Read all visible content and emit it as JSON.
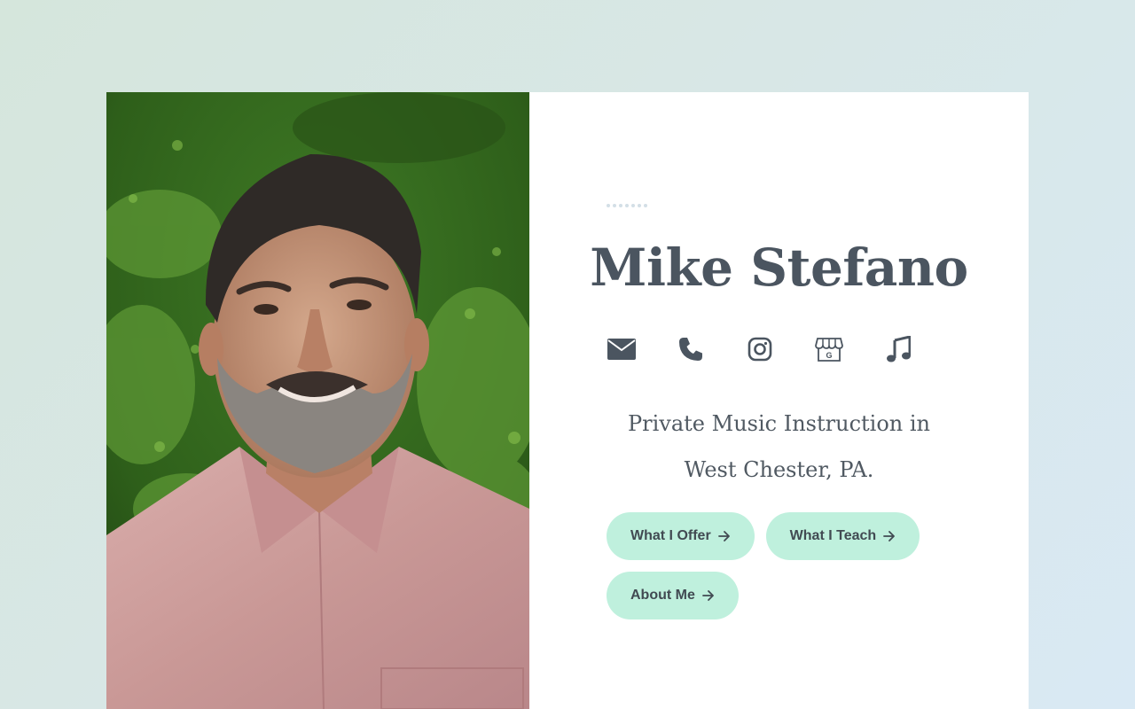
{
  "profile": {
    "name": "Mike Stefano",
    "tagline_line1": "Private Music Instruction in",
    "tagline_line2": "West Chester, PA.",
    "photo_alt": "Portrait of Mike Stefano"
  },
  "contact_icons": [
    {
      "icon": "envelope-icon",
      "label": "Email"
    },
    {
      "icon": "phone-icon",
      "label": "Phone"
    },
    {
      "icon": "instagram-icon",
      "label": "Instagram"
    },
    {
      "icon": "google-business-icon",
      "label": "Google Business"
    },
    {
      "icon": "music-note-icon",
      "label": "Music"
    }
  ],
  "buttons": {
    "offer": "What I Offer",
    "teach": "What I Teach",
    "about": "About Me"
  },
  "colors": {
    "text": "#4b5560",
    "button_bg": "#bff0dd",
    "card_bg": "#ffffff"
  }
}
